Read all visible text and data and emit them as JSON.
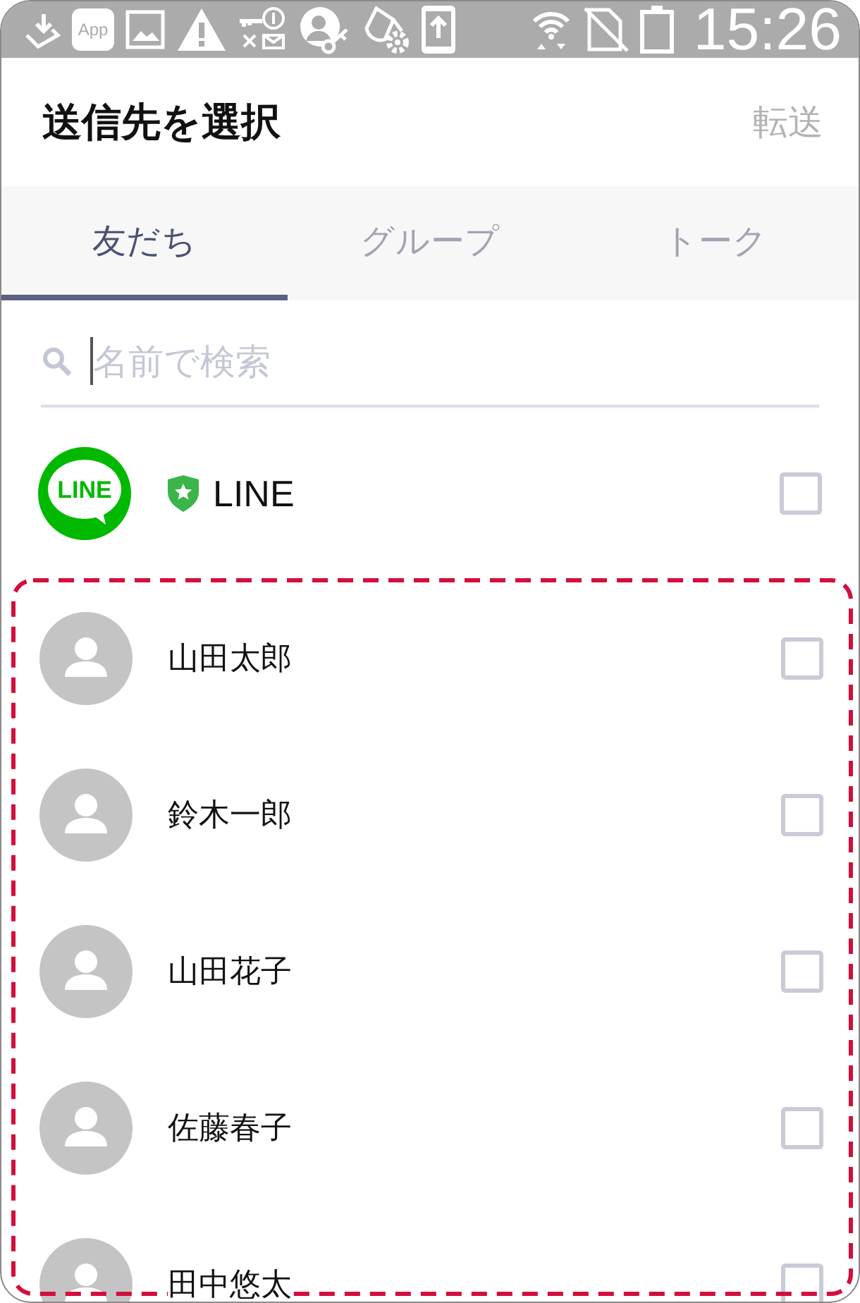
{
  "status_bar": {
    "app_badge": "App",
    "time": "15:26"
  },
  "header": {
    "title": "送信先を選択",
    "action": "転送",
    "action_disabled": true
  },
  "tabs": [
    {
      "label": "友だち",
      "selected": true
    },
    {
      "label": "グループ",
      "selected": false
    },
    {
      "label": "トーク",
      "selected": false
    }
  ],
  "search": {
    "placeholder": "名前で検索",
    "focused": true
  },
  "official_account": {
    "logo_text": "LINE",
    "name": "LINE",
    "verified": true,
    "checked": false
  },
  "contacts": {
    "highlighted": true,
    "items": [
      {
        "name": "山田太郎",
        "checked": false
      },
      {
        "name": "鈴木一郎",
        "checked": false
      },
      {
        "name": "山田花子",
        "checked": false
      },
      {
        "name": "佐藤春子",
        "checked": false
      },
      {
        "name": "田中悠太",
        "checked": false
      }
    ]
  }
}
